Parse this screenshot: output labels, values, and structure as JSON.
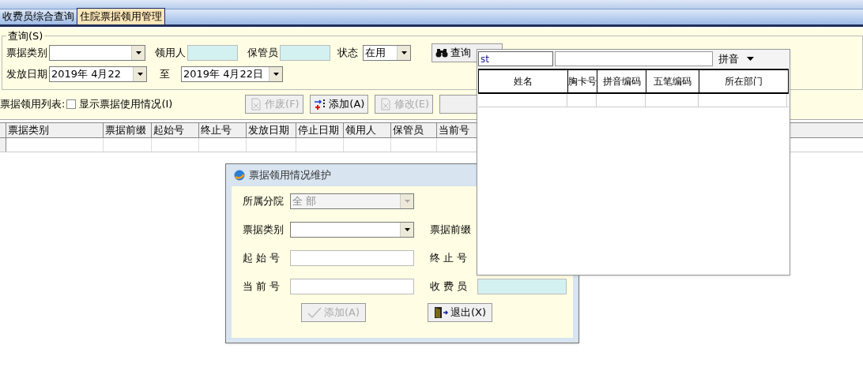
{
  "tabs": [
    {
      "label": "收费员综合查询",
      "selected": false
    },
    {
      "label": "住院票据领用管理",
      "selected": true
    }
  ],
  "query": {
    "title": "查询(S)",
    "row1": [
      {
        "kind": "combo",
        "label": "票据类别"
      },
      {
        "kind": "text",
        "label": "领用人"
      },
      {
        "kind": "text",
        "label": "保管员"
      },
      {
        "kind": "status",
        "label": "状态",
        "value": "在用"
      }
    ],
    "row2": [
      {
        "kind": "date",
        "label": "发放日期",
        "value": "2019年 4月22"
      },
      {
        "kind": "date",
        "label": "至",
        "value": "2019年 4月22日"
      }
    ],
    "search_button": "查询"
  },
  "list": {
    "label": "票据领用列表:",
    "show_usage": {
      "label": "显示票据使用情况(I)",
      "checked": false
    },
    "buttons": [
      {
        "kind": "void",
        "label": "作废(F)",
        "disabled": true
      },
      {
        "kind": "add",
        "label": "添加(A)",
        "disabled": false
      },
      {
        "kind": "edit",
        "label": "修改(E)",
        "disabled": true
      }
    ]
  },
  "table": {
    "columns": [
      "票据类别",
      "票据前缀",
      "起始号",
      "终止号",
      "发放日期",
      "停止日期",
      "领用人",
      "保管员",
      "当前号"
    ]
  },
  "lookup": {
    "search_value": "st",
    "mode": "拼音",
    "columns": [
      "姓名",
      "胸卡号",
      "拼音编码",
      "五笔编码",
      "所在部门"
    ]
  },
  "dialog": {
    "title": "票据领用情况维护",
    "rows": [
      [
        {
          "kind": "combo",
          "label": "所属分院",
          "value": "全 部",
          "disabled": true
        }
      ],
      [
        {
          "kind": "combo",
          "label": "票据类别",
          "disabled": false
        },
        {
          "kind": "label",
          "label": "票据前缀"
        }
      ],
      [
        {
          "kind": "text",
          "label": "起 始 号"
        },
        {
          "kind": "label",
          "label": "终 止 号"
        }
      ],
      [
        {
          "kind": "text",
          "label": "当 前 号"
        },
        {
          "kind": "tinted",
          "label": "收 费 员"
        }
      ]
    ],
    "buttons": [
      {
        "kind": "ok",
        "label": "添加(A)",
        "disabled": true
      },
      {
        "kind": "exit",
        "label": "退出(X)",
        "disabled": false
      }
    ]
  }
}
